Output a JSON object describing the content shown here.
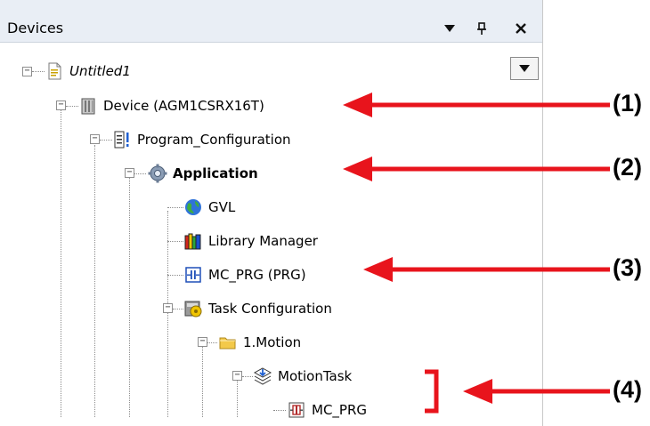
{
  "panel": {
    "title": "Devices",
    "dropdown_glyph": "▼",
    "pin_glyph": "ᵃ",
    "close_glyph": "✕"
  },
  "tree": {
    "root": {
      "label": "Untitled1",
      "icon": "project-file-icon"
    },
    "device": {
      "label": "Device (AGM1CSRX16T)",
      "icon": "device-icon"
    },
    "program_configuration": {
      "label": "Program_Configuration",
      "icon": "program-configuration-icon"
    },
    "application": {
      "label": "Application",
      "icon": "application-gear-icon"
    },
    "gvl": {
      "label": "GVL",
      "icon": "globe-icon"
    },
    "library_manager": {
      "label": "Library Manager",
      "icon": "books-icon"
    },
    "mc_prg": {
      "label": "MC_PRG (PRG)",
      "icon": "program-pou-icon"
    },
    "task_configuration": {
      "label": "Task Configuration",
      "icon": "task-configuration-icon"
    },
    "motion_folder": {
      "label": "1.Motion",
      "icon": "folder-icon"
    },
    "motion_task": {
      "label": "MotionTask",
      "icon": "task-icon"
    },
    "task_mc_prg": {
      "label": "MC_PRG",
      "icon": "program-call-icon"
    }
  },
  "callouts": [
    "(1)",
    "(2)",
    "(3)",
    "(4)"
  ],
  "colors": {
    "arrow": "#e8141c",
    "titlebar": "#e9eef5"
  }
}
